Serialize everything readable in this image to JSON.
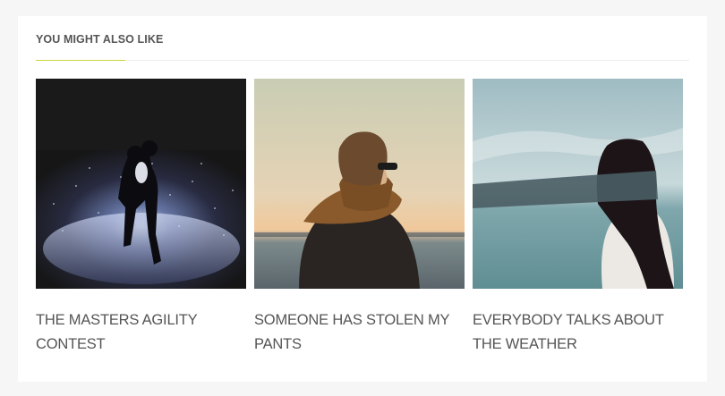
{
  "section": {
    "title": "YOU MIGHT ALSO LIKE",
    "accent_color": "#c9d43a"
  },
  "posts": [
    {
      "title": "THE MASTERS AGILITY CONTEST",
      "image_alt": "couple kissing in falling snow at night"
    },
    {
      "title": "SOMEONE HAS STOLEN MY PANTS",
      "image_alt": "person in scarf and leather jacket looking at the sea"
    },
    {
      "title": "EVERYBODY TALKS ABOUT THE WEATHER",
      "image_alt": "blindfolded woman facing the sea"
    }
  ]
}
